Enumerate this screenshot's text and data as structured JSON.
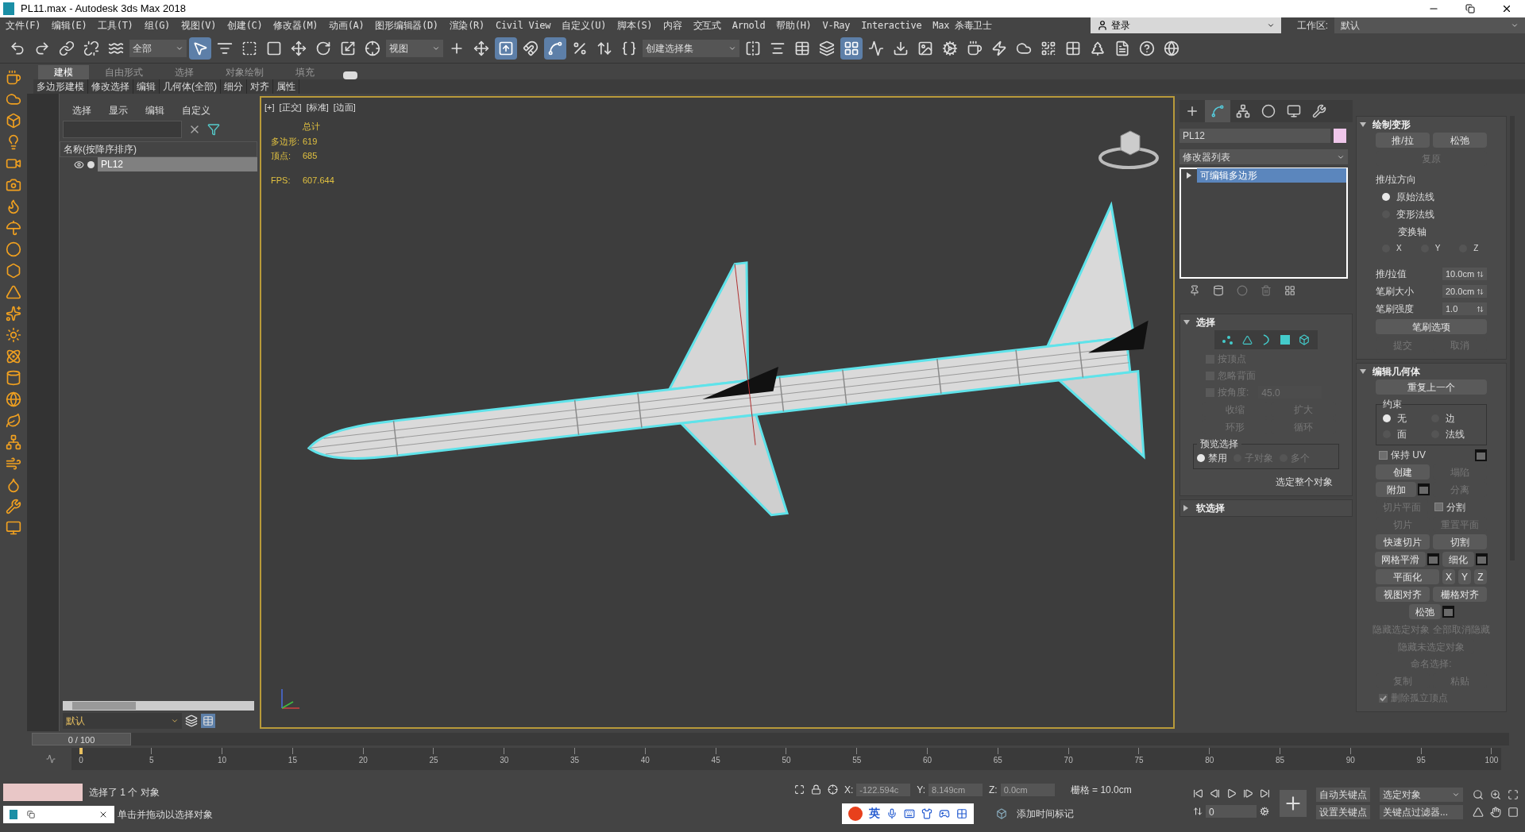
{
  "window": {
    "title": "PL11.max - Autodesk 3ds Max 2018"
  },
  "menu": [
    "文件(F)",
    "编辑(E)",
    "工具(T)",
    "组(G)",
    "视图(V)",
    "创建(C)",
    "修改器(M)",
    "动画(A)",
    "图形编辑器(D)",
    "渲染(R)",
    "Civil View",
    "自定义(U)",
    "脚本(S)",
    "内容",
    "交互式",
    "Arnold",
    "帮助(H)",
    "V-Ray",
    "Interactive",
    "Max 杀毒卫士"
  ],
  "account": {
    "login": "登录",
    "workspace_label": "工作区:",
    "workspace": "默认"
  },
  "toolbar": [
    {
      "kind": "button",
      "selected": false
    },
    {
      "kind": "button",
      "selected": false
    },
    {
      "kind": "button",
      "selected": false
    },
    {
      "kind": "button",
      "selected": false
    },
    {
      "kind": "button",
      "selected": false
    },
    {
      "kind": "dropdown",
      "label": "全部"
    },
    {
      "kind": "button",
      "selected": true
    },
    {
      "kind": "button",
      "selected": false
    },
    {
      "kind": "button",
      "selected": false
    },
    {
      "kind": "button",
      "selected": false
    },
    {
      "kind": "button",
      "selected": false
    },
    {
      "kind": "button",
      "selected": false
    },
    {
      "kind": "button",
      "selected": false
    },
    {
      "kind": "button",
      "selected": false
    },
    {
      "kind": "dropdown",
      "label": "视图"
    },
    {
      "kind": "button",
      "selected": false
    },
    {
      "kind": "button",
      "selected": false
    },
    {
      "kind": "button",
      "selected": true
    },
    {
      "kind": "button",
      "selected": false
    },
    {
      "kind": "button",
      "selected": true
    },
    {
      "kind": "button",
      "selected": false
    },
    {
      "kind": "button",
      "selected": false
    },
    {
      "kind": "button",
      "selected": false
    },
    {
      "kind": "dropdown",
      "label": "创建选择集"
    },
    {
      "kind": "button",
      "selected": false
    },
    {
      "kind": "button",
      "selected": false
    },
    {
      "kind": "button",
      "selected": false
    },
    {
      "kind": "button",
      "selected": false
    },
    {
      "kind": "button",
      "selected": true
    },
    {
      "kind": "button",
      "selected": false
    },
    {
      "kind": "button",
      "selected": false
    },
    {
      "kind": "button",
      "selected": false
    },
    {
      "kind": "button",
      "selected": false
    },
    {
      "kind": "button",
      "selected": false
    },
    {
      "kind": "button",
      "selected": false
    },
    {
      "kind": "button",
      "selected": false
    },
    {
      "kind": "button",
      "selected": false
    },
    {
      "kind": "button",
      "selected": false
    },
    {
      "kind": "button",
      "selected": false
    },
    {
      "kind": "button",
      "selected": false
    },
    {
      "kind": "button",
      "selected": false
    },
    {
      "kind": "button",
      "selected": false
    }
  ],
  "ribbon": {
    "tabs": [
      {
        "label": "建模",
        "selected": true
      },
      {
        "label": "自由形式",
        "selected": false
      },
      {
        "label": "选择",
        "selected": false
      },
      {
        "label": "对象绘制",
        "selected": false
      },
      {
        "label": "填充",
        "selected": false
      }
    ],
    "panels": [
      "多边形建模",
      "修改选择",
      "编辑",
      "几何体(全部)",
      "细分",
      "对齐",
      "属性"
    ]
  },
  "scene_explorer": {
    "menu": [
      "选择",
      "显示",
      "编辑",
      "自定义"
    ],
    "column_header": "名称(按降序排序)",
    "rows": [
      {
        "name": "PL12",
        "selected": true
      }
    ],
    "layer": "默认"
  },
  "viewport": {
    "labels": [
      "[+]",
      "[正交]",
      "[标准]",
      "[边面]"
    ],
    "stats": {
      "heading": "总计",
      "rows": [
        {
          "label": "多边形:",
          "value": "619"
        },
        {
          "label": "顶点:",
          "value": "685"
        }
      ],
      "fps_label": "FPS:",
      "fps": "607.644"
    }
  },
  "command_panel": {
    "tabs": [
      {
        "selected": false
      },
      {
        "selected": true
      },
      {
        "selected": false
      },
      {
        "selected": false
      },
      {
        "selected": false
      },
      {
        "selected": false
      }
    ],
    "object_name": "PL12",
    "modifier_list": "修改器列表",
    "stack": [
      {
        "name": "可编辑多边形",
        "selected": true
      }
    ],
    "selection": {
      "title": "选择",
      "expanded": true,
      "levels": [
        {
          "selected": false
        },
        {
          "selected": false
        },
        {
          "selected": false
        },
        {
          "selected": false
        },
        {
          "selected": false
        }
      ],
      "options": [
        {
          "label": "按顶点",
          "checked": false,
          "disabled": true
        },
        {
          "label": "忽略背面",
          "checked": false,
          "disabled": true
        },
        {
          "label": "按角度:",
          "checked": false,
          "disabled": true,
          "value": "45.0"
        }
      ],
      "buttons": [
        {
          "label": "收缩",
          "disabled": true
        },
        {
          "label": "扩大",
          "disabled": true
        },
        {
          "label": "环形",
          "disabled": true
        },
        {
          "label": "循环",
          "disabled": true
        }
      ],
      "preview": {
        "title": "预览选择",
        "options": [
          {
            "label": "禁用",
            "selected": true,
            "disabled": false
          },
          {
            "label": "子对象",
            "selected": false,
            "disabled": true
          },
          {
            "label": "多个",
            "selected": false,
            "disabled": true
          }
        ]
      },
      "status": "选定整个对象"
    },
    "soft_selection": {
      "title": "软选择",
      "expanded": false
    },
    "paint_deformation": {
      "title": "绘制变形",
      "expanded": true,
      "buttons": [
        {
          "label": "推/拉",
          "disabled": false
        },
        {
          "label": "松弛",
          "disabled": false
        }
      ],
      "revert": {
        "label": "复原",
        "disabled": true
      },
      "direction": {
        "title": "推/拉方向",
        "options": [
          {
            "label": "原始法线",
            "selected": true
          },
          {
            "label": "变形法线",
            "selected": false
          }
        ],
        "axis_label": "变换轴",
        "axes": [
          {
            "label": "X",
            "selected": false
          },
          {
            "label": "Y",
            "selected": false
          },
          {
            "label": "Z",
            "selected": false
          }
        ]
      },
      "spinners": [
        {
          "label": "推/拉值",
          "value": "10.0cm"
        },
        {
          "label": "笔刷大小",
          "value": "20.0cm"
        },
        {
          "label": "笔刷强度",
          "value": "1.0"
        }
      ],
      "brush_options": {
        "label": "笔刷选项",
        "disabled": false
      },
      "actions": [
        {
          "label": "提交",
          "disabled": true
        },
        {
          "label": "取消",
          "disabled": true
        }
      ]
    },
    "edit_geometry": {
      "title": "编辑几何体",
      "expanded": true,
      "repeat": {
        "label": "重复上一个",
        "disabled": false
      },
      "constraints": {
        "title": "约束",
        "options": [
          {
            "label": "无",
            "selected": true
          },
          {
            "label": "边",
            "selected": false
          },
          {
            "label": "面",
            "selected": false
          },
          {
            "label": "法线",
            "selected": false
          }
        ]
      },
      "rows": [
        [
          {
            "kind": "checkbox",
            "label": "保持 UV",
            "checked": false,
            "disabled": false
          },
          {
            "kind": "settings"
          }
        ],
        [
          {
            "kind": "button",
            "label": "创建",
            "disabled": false
          },
          {
            "kind": "button",
            "label": "塌陷",
            "disabled": true
          }
        ],
        [
          {
            "kind": "button-settings",
            "label": "附加",
            "disabled": false
          },
          {
            "kind": "button",
            "label": "分离",
            "disabled": true
          }
        ],
        [
          {
            "kind": "button",
            "label": "切片平面",
            "disabled": true
          },
          {
            "kind": "checkbox",
            "label": "分割",
            "checked": false,
            "disabled": false
          }
        ],
        [
          {
            "kind": "button",
            "label": "切片",
            "disabled": true
          },
          {
            "kind": "button",
            "label": "重置平面",
            "disabled": true
          }
        ],
        [
          {
            "kind": "button",
            "label": "快速切片",
            "disabled": false
          },
          {
            "kind": "button",
            "label": "切割",
            "disabled": false
          }
        ],
        [
          {
            "kind": "button-settings",
            "label": "网格平滑",
            "disabled": false
          },
          {
            "kind": "button-settings",
            "label": "细化",
            "disabled": false
          }
        ],
        [
          {
            "kind": "button",
            "label": "平面化",
            "disabled": false
          },
          {
            "kind": "axis",
            "label": "X",
            "disabled": false
          },
          {
            "kind": "axis",
            "label": "Y",
            "disabled": false
          },
          {
            "kind": "axis",
            "label": "Z",
            "disabled": false
          }
        ],
        [
          {
            "kind": "button",
            "label": "视图对齐",
            "disabled": false
          },
          {
            "kind": "button",
            "label": "栅格对齐",
            "disabled": false
          }
        ],
        [
          {
            "kind": "button-settings",
            "label": "松弛",
            "disabled": false
          }
        ],
        [
          {
            "kind": "button",
            "label": "隐藏选定对象",
            "disabled": true
          },
          {
            "kind": "button",
            "label": "全部取消隐藏",
            "disabled": true
          }
        ],
        [
          {
            "kind": "button",
            "label": "隐藏未选定对象",
            "disabled": true
          }
        ],
        [
          {
            "kind": "label",
            "label": "命名选择:",
            "disabled": true
          }
        ],
        [
          {
            "kind": "button",
            "label": "复制",
            "disabled": true
          },
          {
            "kind": "button",
            "label": "粘贴",
            "disabled": true
          }
        ],
        [
          {
            "kind": "checkbox",
            "label": "删除孤立顶点",
            "checked": true,
            "disabled": true
          }
        ]
      ]
    }
  },
  "timeline": {
    "slider": "0 / 100",
    "level": 0,
    "ticks": [
      "0",
      "5",
      "10",
      "15",
      "20",
      "25",
      "30",
      "35",
      "40",
      "45",
      "50",
      "55",
      "60",
      "65",
      "70",
      "75",
      "80",
      "85",
      "90",
      "95",
      "100"
    ]
  },
  "status_bar": {
    "selection": "选择了 1 个 对象",
    "prompt": "单击并拖动以选择对象",
    "coords": [
      {
        "label": "X:",
        "value": "-122.594c"
      },
      {
        "label": "Y:",
        "value": "8.149cm"
      },
      {
        "label": "Z:",
        "value": "0.0cm"
      }
    ],
    "grid": "栅格 = 10.0cm",
    "ime": "英",
    "time_tag": "添加时间标记",
    "frame": "0",
    "auto_key": "自动关键点",
    "set_key": "设置关键点",
    "key_mode": "选定对象",
    "key_filters": "关键点过滤器..."
  }
}
